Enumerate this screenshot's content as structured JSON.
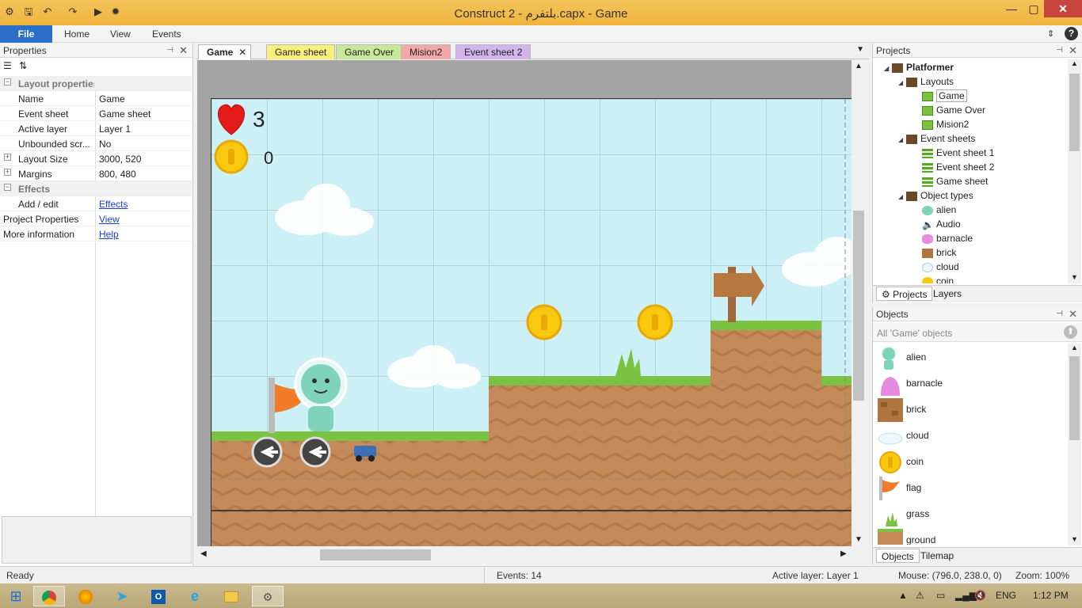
{
  "window": {
    "title": "Construct 2 - بلتفرم.capx - Game",
    "minimize": "—",
    "maximize": "▢",
    "close": "✕"
  },
  "ribbon": {
    "file": "File",
    "home": "Home",
    "view": "View",
    "events": "Events"
  },
  "properties": {
    "title": "Properties",
    "section_layout": "Layout properties",
    "rows": [
      {
        "k": "Name",
        "v": "Game"
      },
      {
        "k": "Event sheet",
        "v": "Game sheet"
      },
      {
        "k": "Active layer",
        "v": "Layer 1"
      },
      {
        "k": "Unbounded scr...",
        "v": "No"
      },
      {
        "k": "Layout Size",
        "v": "3000, 520"
      },
      {
        "k": "Margins",
        "v": "800, 480"
      }
    ],
    "section_effects": "Effects",
    "add_edit": "Add / edit",
    "effects_link": "Effects",
    "project_props": "Project Properties",
    "view_link": "View",
    "more_info": "More information",
    "help_link": "Help"
  },
  "doc_tabs": [
    {
      "label": "Game",
      "color": "#ffffff"
    },
    {
      "label": "Game sheet",
      "color": "#f9ef7a"
    },
    {
      "label": "Game Over",
      "color": "#c9e79a"
    },
    {
      "label": "Mision2",
      "color": "#f4a7a7"
    },
    {
      "label": "Event sheet 2",
      "color": "#d4b4ec"
    }
  ],
  "hud": {
    "lives": "3",
    "coins": "0"
  },
  "projects": {
    "title": "Projects",
    "root": "Platformer",
    "layouts": "Layouts",
    "layout_items": [
      "Game",
      "Game Over",
      "Mision2"
    ],
    "event_sheets": "Event sheets",
    "event_items": [
      "Event sheet 1",
      "Event sheet 2",
      "Game sheet"
    ],
    "object_types": "Object types",
    "object_items": [
      "alien",
      "Audio",
      "barnacle",
      "brick",
      "cloud",
      "coin"
    ],
    "tab_projects": "Projects",
    "tab_layers": "Layers"
  },
  "objects": {
    "title": "Objects",
    "filter": "All 'Game' objects",
    "items": [
      "alien",
      "barnacle",
      "brick",
      "cloud",
      "coin",
      "flag",
      "grass",
      "ground"
    ],
    "tab_objects": "Objects",
    "tab_tilemap": "Tilemap"
  },
  "status": {
    "ready": "Ready",
    "events": "Events: 14",
    "active_layer": "Active layer: Layer 1",
    "mouse": "Mouse: (796.0, 238.0, 0)",
    "zoom": "Zoom: 100%"
  },
  "taskbar": {
    "lang": "ENG",
    "time": "1:12 PM"
  },
  "colors": {
    "accent": "#2a6fc9",
    "titlebar": "#f0b43e",
    "sky": "#cdf0f7",
    "grass": "#7cc242",
    "dirt": "#c8895a"
  }
}
